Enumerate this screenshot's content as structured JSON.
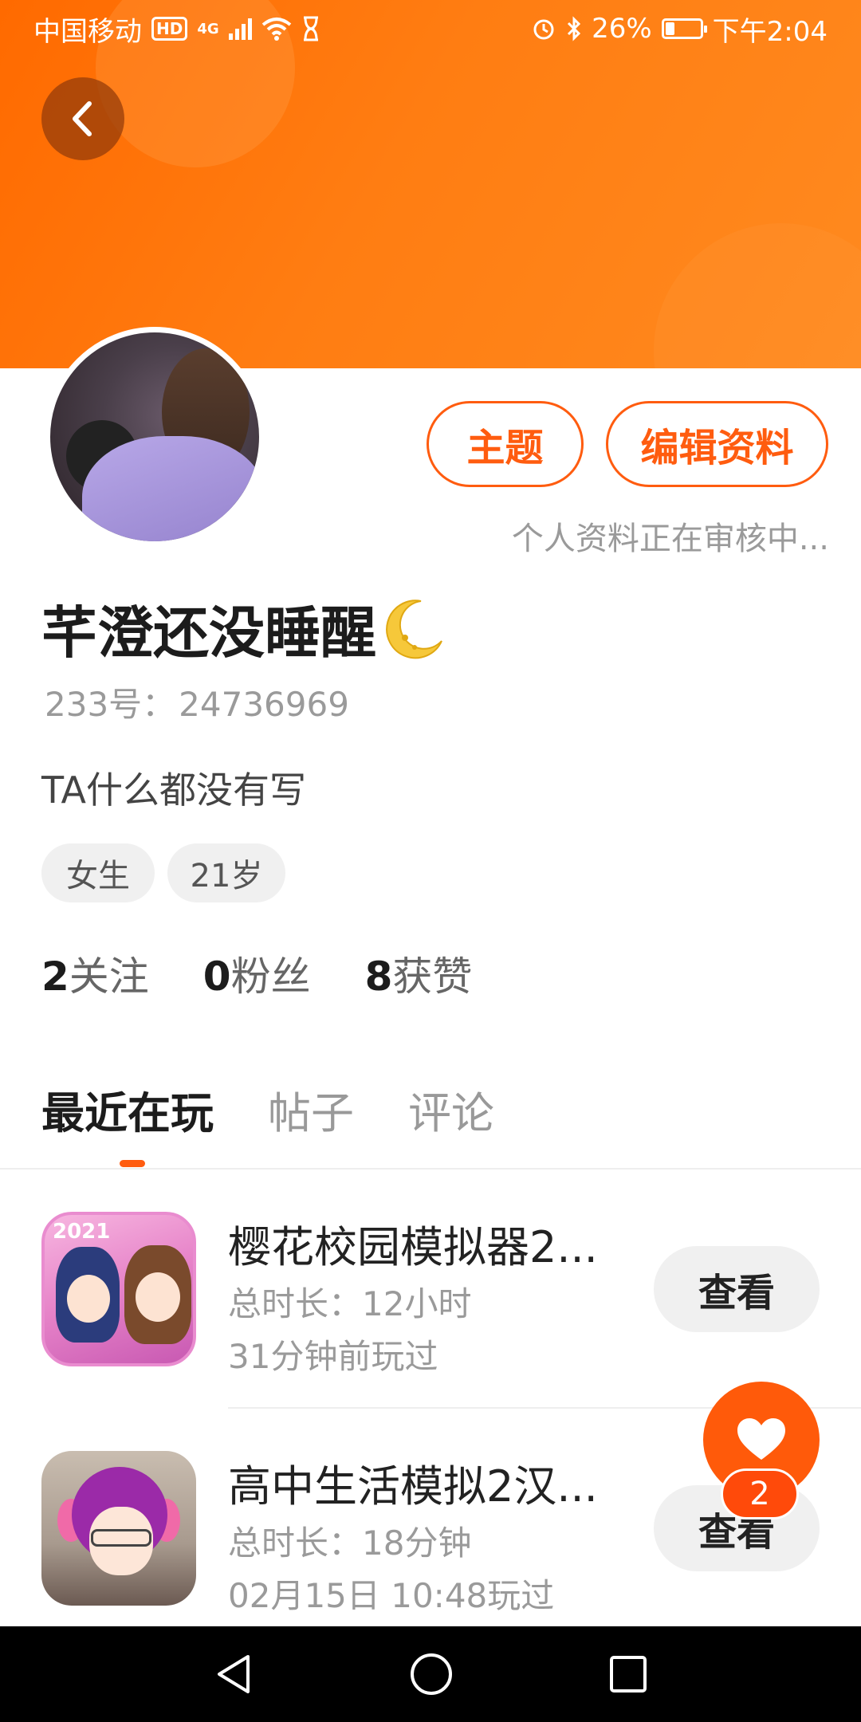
{
  "status_bar": {
    "carrier": "中国移动",
    "hd": "HD",
    "network": "4G",
    "battery": "26%",
    "battery_level": 0.26,
    "time": "下午2:04"
  },
  "profile": {
    "buttons": {
      "theme": "主题",
      "edit": "编辑资料"
    },
    "review_note": "个人资料正在审核中...",
    "nickname": "芊澄还没睡醒",
    "uid_label": "233号：",
    "uid_value": "24736969",
    "bio": "TA什么都没有写",
    "tags": [
      "女生",
      "21岁"
    ],
    "stats": [
      {
        "count": "2",
        "label": "关注"
      },
      {
        "count": "0",
        "label": "粉丝"
      },
      {
        "count": "8",
        "label": "获赞"
      }
    ]
  },
  "tabs": [
    "最近在玩",
    "帖子",
    "评论"
  ],
  "active_tab": "最近在玩",
  "games": [
    {
      "icon_year": "2021",
      "title": "樱花校园模拟器2...",
      "duration": "总时长：12小时",
      "last_played": "31分钟前玩过",
      "button": "查看"
    },
    {
      "title": "高中生活模拟2汉...",
      "duration": "总时长：18分钟",
      "last_played": "02月15日 10:48玩过",
      "button": "查看"
    }
  ],
  "like_fab": {
    "badge": "2"
  },
  "colors": {
    "accent": "#ff5c0f",
    "header": "#ff7a10",
    "nav": "#000000"
  },
  "icons": [
    "back-arrow-icon",
    "heart-icon",
    "moon-emoji-icon",
    "nav-back-icon",
    "nav-home-icon",
    "nav-recents-icon"
  ]
}
